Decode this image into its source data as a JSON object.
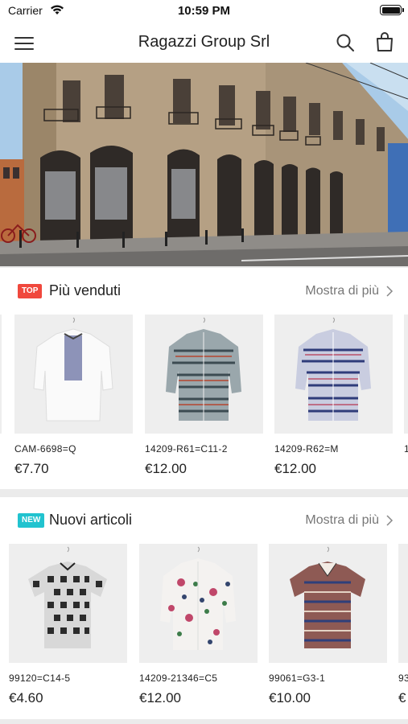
{
  "status_bar": {
    "carrier": "Carrier",
    "time": "10:59 PM"
  },
  "navbar": {
    "title": "Ragazzi Group Srl",
    "icons": [
      "menu-icon",
      "search-icon",
      "shopping-bag-icon"
    ]
  },
  "hero": {
    "image": "storefront-building-photo"
  },
  "colors": {
    "badge_top": "#f0483d",
    "badge_new": "#21c3cf",
    "price": "#222222",
    "more_link": "#777777"
  },
  "bestsellers": {
    "badge": "TOP",
    "title": "Più venduti",
    "more": "Mostra di più",
    "products": [
      {
        "sku": "CAM-6698=Q",
        "price": "€7.70"
      },
      {
        "sku": "14209-R61=C11-2",
        "price": "€12.00"
      },
      {
        "sku": "14209-R62=M",
        "price": "€12.00"
      },
      {
        "sku": "1",
        "price": ""
      }
    ]
  },
  "new_items": {
    "badge": "NEW",
    "title": "Nuovi articoli",
    "more": "Mostra di più",
    "products": [
      {
        "sku": "99120=C14-5",
        "price": "€4.60"
      },
      {
        "sku": "14209-21346=C5",
        "price": "€12.00"
      },
      {
        "sku": "99061=G3-1",
        "price": "€10.00"
      },
      {
        "sku": "93",
        "price": "€"
      }
    ]
  }
}
